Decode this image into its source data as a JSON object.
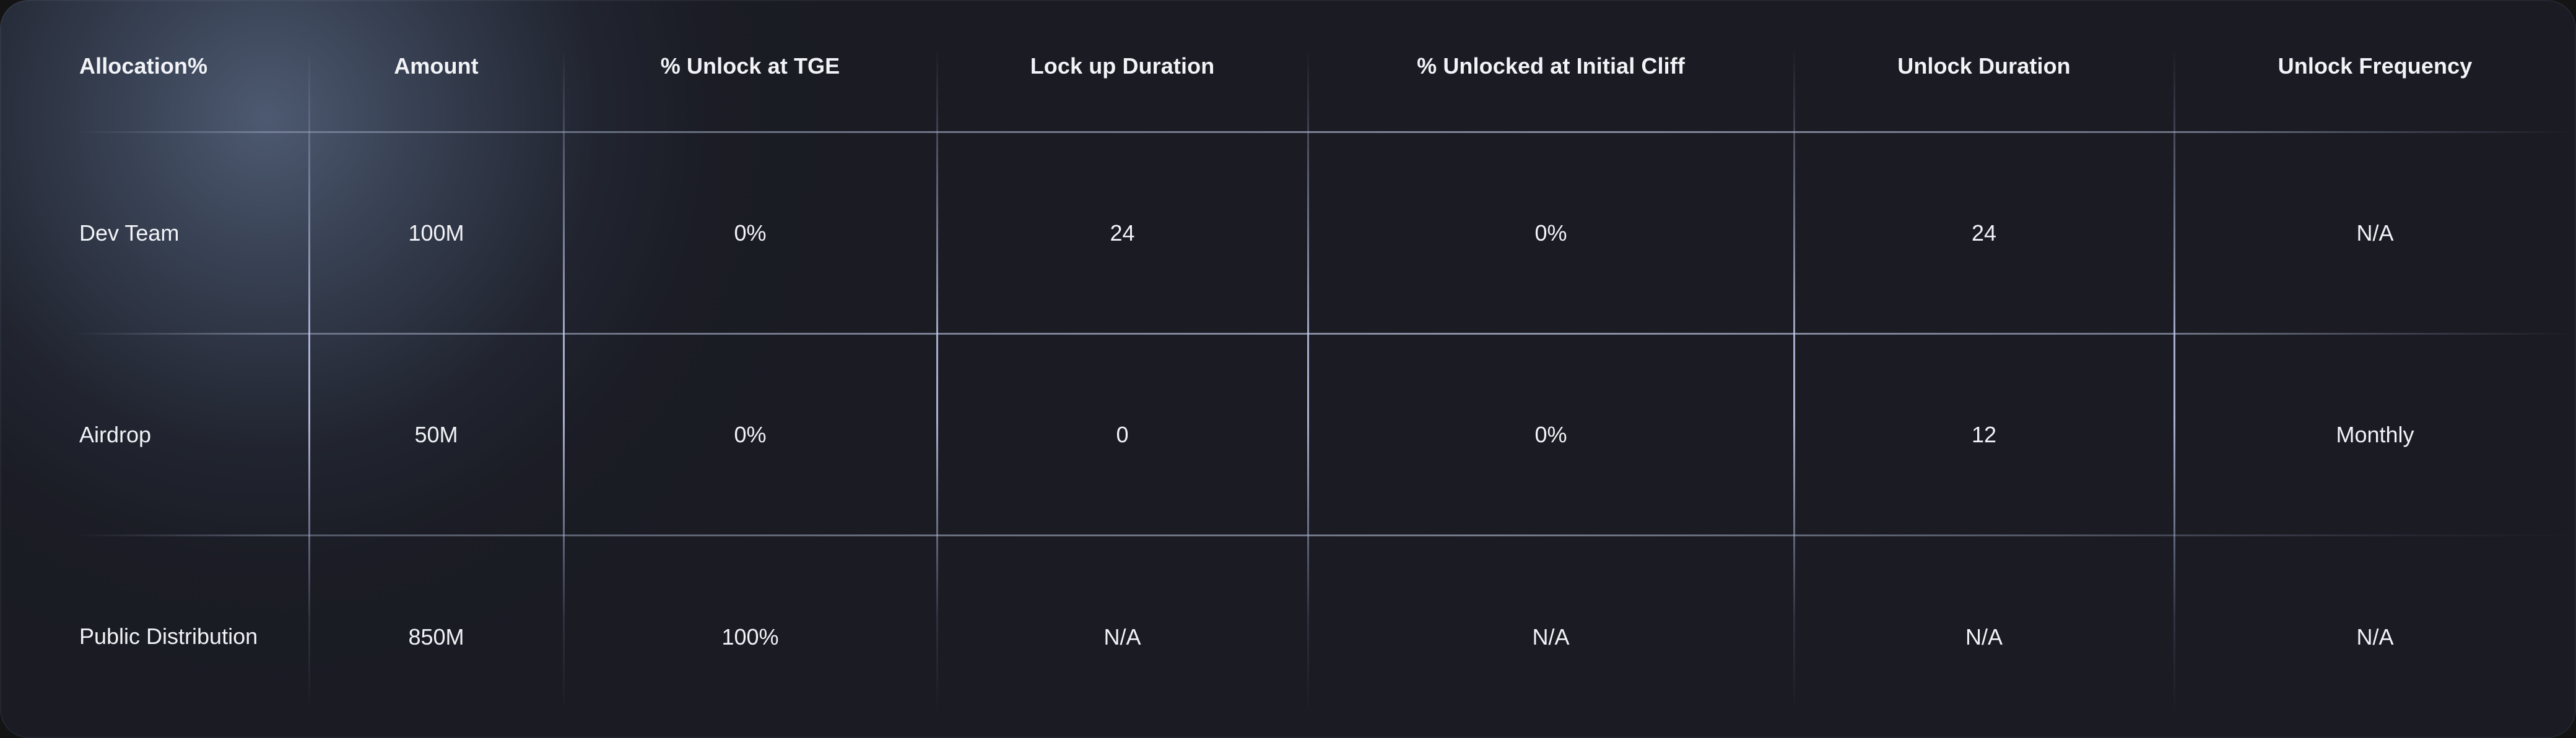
{
  "table": {
    "columns": [
      {
        "label": "Allocation%",
        "align": "left"
      },
      {
        "label": "Amount",
        "align": "center"
      },
      {
        "label": "% Unlock at TGE",
        "align": "center"
      },
      {
        "label": "Lock up Duration",
        "align": "center"
      },
      {
        "label": "% Unlocked at Initial Cliff",
        "align": "center"
      },
      {
        "label": "Unlock Duration",
        "align": "center"
      },
      {
        "label": "Unlock Frequency",
        "align": "center"
      }
    ],
    "rows": [
      {
        "allocation": "Dev Team",
        "amount": "100M",
        "unlock_at_tge": "0%",
        "lock_up_duration": "24",
        "unlocked_at_initial_cliff": "0%",
        "unlock_duration": "24",
        "unlock_frequency": "N/A"
      },
      {
        "allocation": "Airdrop",
        "amount": "50M",
        "unlock_at_tge": "0%",
        "lock_up_duration": "0",
        "unlocked_at_initial_cliff": "0%",
        "unlock_duration": "12",
        "unlock_frequency": "Monthly"
      },
      {
        "allocation": "Public Distribution",
        "amount": "850M",
        "unlock_at_tge": "100%",
        "lock_up_duration": "N/A",
        "unlocked_at_initial_cliff": "N/A",
        "unlock_duration": "N/A",
        "unlock_frequency": "N/A"
      }
    ]
  },
  "colors": {
    "page_background": "#141414",
    "card_background": "#1a1b23",
    "corner_glow": "#6c80a0",
    "divider_accent": "#c4cbee",
    "row_border": "#b8c2de",
    "text_primary": "#f4f5f8",
    "header_text": "#fafbfd"
  }
}
